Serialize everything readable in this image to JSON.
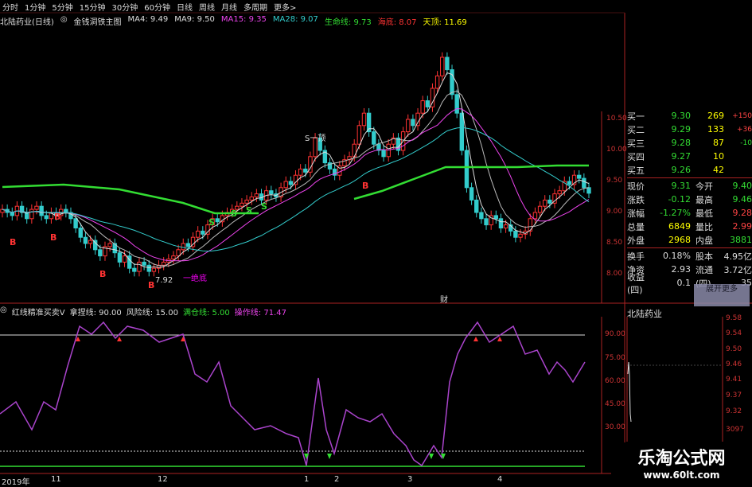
{
  "toolbar": {
    "items": [
      "分时",
      "1分钟",
      "5分钟",
      "15分钟",
      "30分钟",
      "60分钟",
      "日线",
      "周线",
      "月线",
      "多周期",
      "更多>"
    ]
  },
  "header": {
    "stock_title": "北陆药业(日线)",
    "indicator_name": "金钱洞铁主图",
    "ma": [
      {
        "label": "MA4: 9.49",
        "color": "#dddddd"
      },
      {
        "label": "MA9: 9.50",
        "color": "#dddddd"
      },
      {
        "label": "MA15: 9.35",
        "color": "#ee44ee"
      },
      {
        "label": "MA28: 9.07",
        "color": "#33cccc"
      },
      {
        "label": "生命线: 9.73",
        "color": "#33dd33"
      },
      {
        "label": "海底: 8.07",
        "color": "#ff3333"
      },
      {
        "label": "天顶: 11.69",
        "color": "#ffff00"
      }
    ]
  },
  "price_axis": [
    "10.50",
    "10.00",
    "9.50",
    "9.00",
    "8.50",
    "8.00"
  ],
  "chart_labels": {
    "low_price": "7.92",
    "buy_marker": "B",
    "sell_marker": "S",
    "sell_first": "S一顶",
    "first_bottom": "一绝底",
    "fin_marker": "财"
  },
  "quotes": {
    "bids": [
      {
        "label": "买一",
        "price": "9.30",
        "vol": "269",
        "chg": "+150"
      },
      {
        "label": "买二",
        "price": "9.29",
        "vol": "133",
        "chg": "+36"
      },
      {
        "label": "买三",
        "price": "9.28",
        "vol": "87",
        "chg": "-10"
      },
      {
        "label": "买四",
        "price": "9.27",
        "vol": "10",
        "chg": ""
      },
      {
        "label": "买五",
        "price": "9.26",
        "vol": "42",
        "chg": ""
      }
    ],
    "stats": [
      {
        "l1": "现价",
        "v1": "9.31",
        "l2": "今开",
        "v2": "9.40"
      },
      {
        "l1": "涨跌",
        "v1": "-0.12",
        "l2": "最高",
        "v2": "9.46"
      },
      {
        "l1": "涨幅",
        "v1": "-1.27%",
        "l2": "最低",
        "v2": "9.28"
      },
      {
        "l1": "总量",
        "v1": "6849",
        "l2": "量比",
        "v2": "2.99"
      },
      {
        "l1": "外盘",
        "v1": "2968",
        "l2": "内盘",
        "v2": "3881"
      }
    ],
    "extra": [
      {
        "l1": "换手",
        "v1": "0.18%",
        "l2": "股本",
        "v2": "4.95亿"
      },
      {
        "l1": "净资",
        "v1": "2.93",
        "l2": "流通",
        "v2": "3.72亿"
      },
      {
        "l1": "收益(四)",
        "v1": "0.1",
        "l2": "(四)",
        "v2": "35"
      }
    ],
    "popup_text": "展开更多"
  },
  "indicator": {
    "title": "红线精准买卖V",
    "params": [
      {
        "label": "拿捏线: 90.00",
        "color": "#dddddd"
      },
      {
        "label": "风险线: 15.00",
        "color": "#dddddd"
      },
      {
        "label": "满仓线: 5.00",
        "color": "#33dd33"
      },
      {
        "label": "操作线: 71.47",
        "color": "#ee44ee"
      }
    ],
    "axis": [
      "90.00",
      "75.00",
      "60.00",
      "45.00",
      "30.00"
    ]
  },
  "mini": {
    "title": "北陆药业",
    "axis": [
      "9.58",
      "9.54",
      "9.50",
      "9.46",
      "9.41",
      "9.37",
      "9.32",
      "3097"
    ]
  },
  "date_axis": [
    "2019年",
    "11",
    "12",
    "1",
    "2",
    "3",
    "4"
  ],
  "watermark": {
    "line1": "乐淘公式网",
    "line2": "www.60lt.com"
  },
  "colors": {
    "up": "#ff3333",
    "down": "#33cccc",
    "life_line": "#33dd33",
    "ma15": "#ee44ee",
    "border": "#aa2222"
  }
}
